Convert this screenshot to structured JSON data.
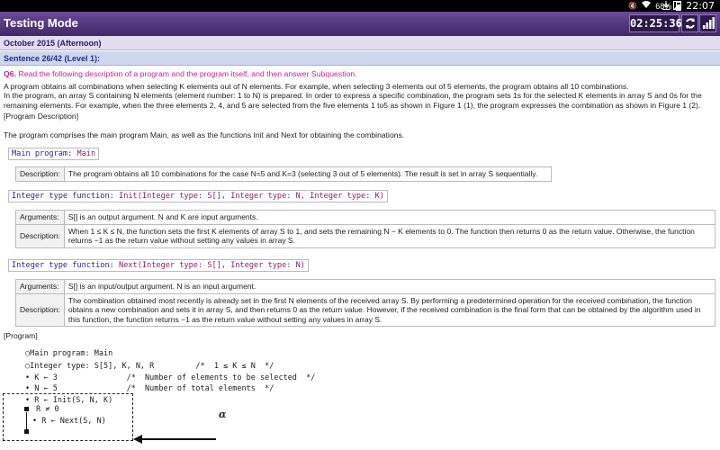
{
  "status_bar": {
    "battery": "68%",
    "time": "22:07",
    "icons": [
      "download-icon",
      "image-icon",
      "mute-icon",
      "wifi-icon",
      "battery-icon"
    ]
  },
  "header": {
    "title": "Testing Mode",
    "timer": "02:25:36",
    "icons": [
      "refresh-icon",
      "signal-bars-icon"
    ]
  },
  "exam": {
    "session": "October 2015 (Afternoon)",
    "sentence": "Sentence 26/42 (Level 1):"
  },
  "question": {
    "number": "Q6.",
    "prompt": "Read the following description of a program and the program itself, and then answer Subquestion.",
    "intro_1": "A program obtains all combinations when selecting K elements out of N elements. For example, when selecting 3 elements out of 5 elements, the program obtains all 10 combinations.",
    "intro_2": "In the program, an array S containing N elements (element number: 1 to N) is prepared. In order to express a specific combination, the program sets 1s for the selected K elements in array S and 0s for the remaining elements. For example, when the three elements 2, 4, and 5 are selected from the five elements 1 to5 as shown in Figure 1 (1), the program expresses the combination as shown in Figure 1 (2).",
    "prog_desc_label": "[Program Description]",
    "comprises": "The program comprises the main program Main, as well as the functions Init and Next for obtaining the combinations."
  },
  "main_program": {
    "kw": "Main program:",
    "name": "Main",
    "description_label": "Description:",
    "description": "The program obtains all 10 combinations for the case N=5 and K=3 (selecting 3 out of 5 elements). The result is set in array S sequentially."
  },
  "init_function": {
    "kw": "Integer type function:",
    "signature": "Init(Integer type: S[], Integer type: N, Integer type: K)",
    "arguments_label": "Arguments:",
    "arguments": "S[] is an output argument. N and K are input arguments.",
    "description_label": "Description:",
    "description": "When 1 ≤ K ≤ N, the function sets the first K elements of array S to 1, and sets the remaining N − K elements to 0. The function then returns 0 as the return value. Otherwise, the function returns −1 as the return value without setting any values in array S."
  },
  "next_function": {
    "kw": "Integer type function:",
    "signature": "Next(Integer type: S[], Integer type: N)",
    "arguments_label": "Arguments:",
    "arguments": "S[] is an input/output argument. N is an input argument.",
    "description_label": "Description:",
    "description": "The combination obtained most recently is already set in the first N elements of the received array S. By performing a predetermined operation for the received combination, the function obtains a new combination and sets it in array S, and then returns 0 as the return value. However, if the received combination is the final form that can be obtained by the algorithm used in this function, the function returns −1 as the return value without setting any values in array S."
  },
  "program": {
    "label": "[Program]",
    "lines": [
      "○Main program: Main",
      "○Integer type: S[5], K, N, R         /*  1 ≤ K ≤ N  */",
      "• K ← 3               /*  Number of elements to be selected  */",
      "• N ← 5               /*  Number of total elements  */",
      "• R ← Init(S, N, K)",
      "R ≠ 0",
      "• R ← Next(S, N)"
    ],
    "alpha": "α"
  }
}
